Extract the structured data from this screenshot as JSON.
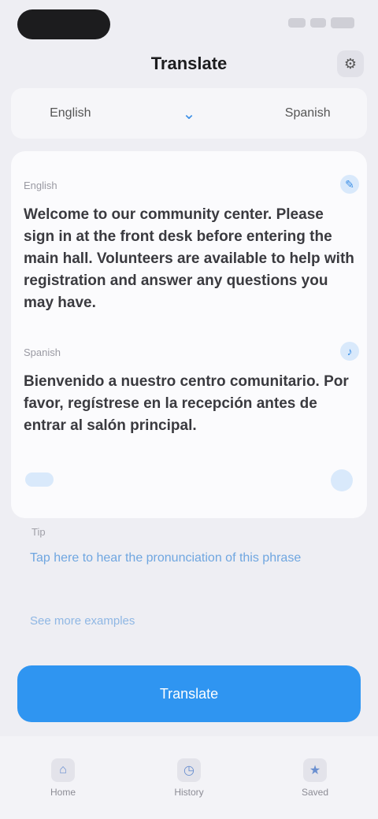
{
  "status_bar": {
    "time_icon": "pill-icon",
    "indicators": [
      "signal-icon",
      "wifi-icon",
      "battery-icon"
    ]
  },
  "header": {
    "title": "Translate",
    "action_icon": "gear-icon"
  },
  "language_bar": {
    "source": "English",
    "swap_icon": "chevron-down-icon",
    "target": "Spanish"
  },
  "source_block": {
    "meta": "English",
    "text": "Welcome to our community center. Please sign in at the front desk before entering the main hall. Volunteers are available to help with registration and answer any questions you may have."
  },
  "target_block": {
    "meta": "Spanish",
    "text": "Bienvenido a nuestro centro comunitario. Por favor, regístrese en la recepción antes de entrar al salón principal."
  },
  "suggestion": {
    "label": "Tip",
    "link_text": "Tap here to hear the pronunciation of this phrase",
    "secondary_link": "See more examples"
  },
  "primary_action": {
    "label": "Translate"
  },
  "bottom_nav": [
    {
      "icon": "home-icon",
      "label": "Home"
    },
    {
      "icon": "history-icon",
      "label": "History"
    },
    {
      "icon": "saved-icon",
      "label": "Saved"
    }
  ],
  "colors": {
    "accent": "#2f95f1",
    "background": "#eeeef3"
  }
}
